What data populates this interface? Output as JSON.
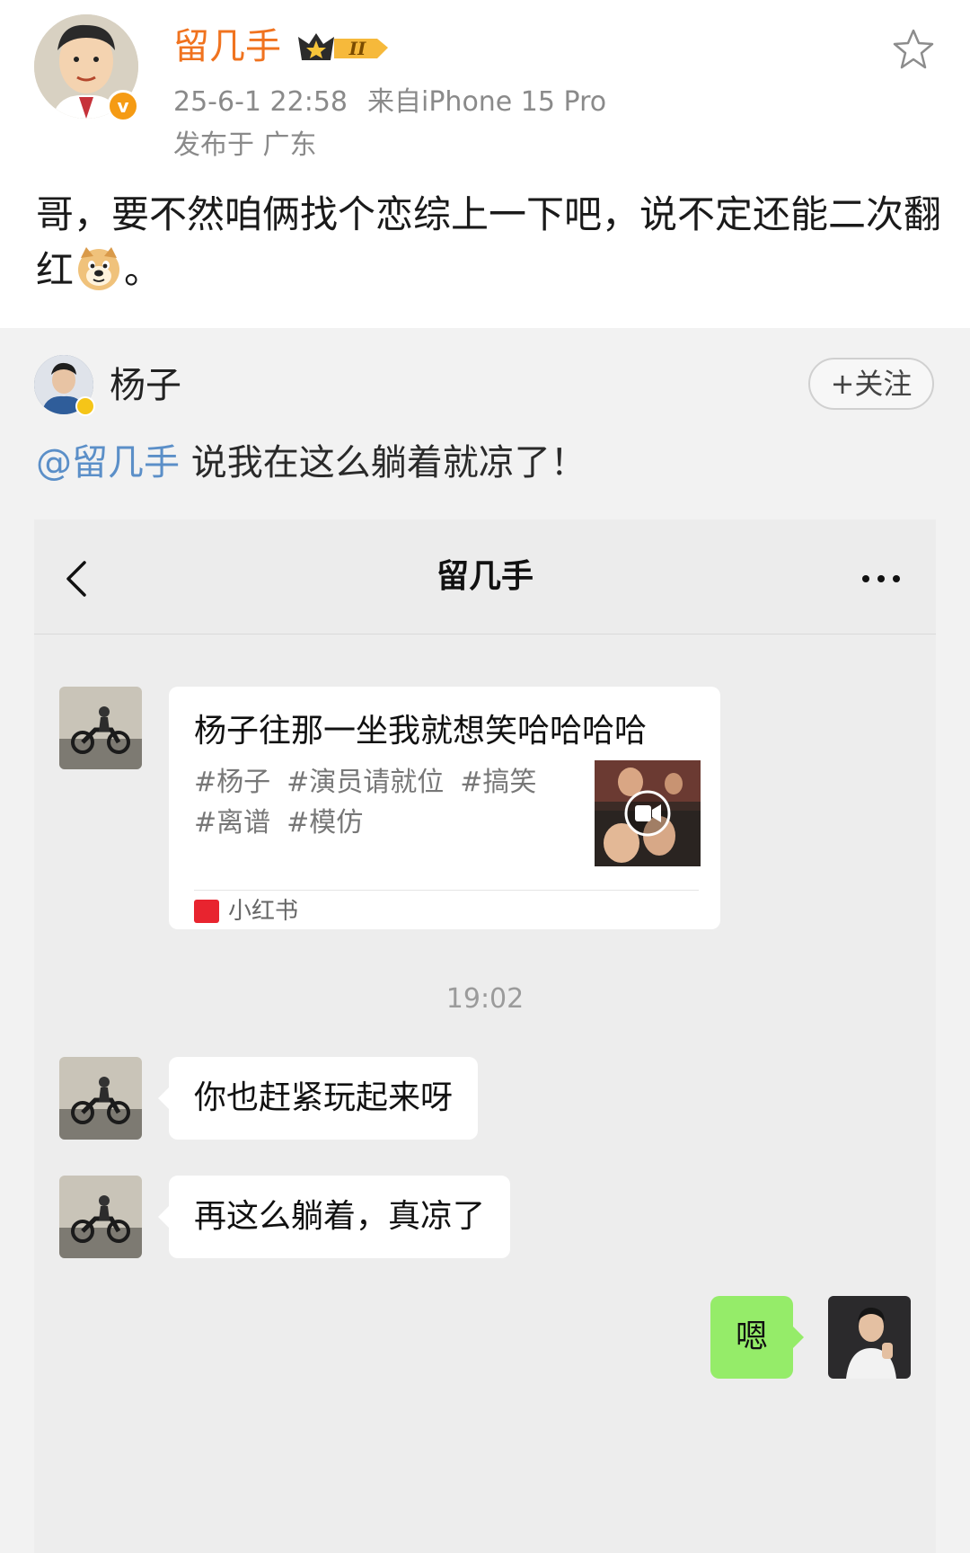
{
  "post": {
    "author": "留几手",
    "vip_label": "II",
    "time": "25-6-1 22:58",
    "source": "来自iPhone 15 Pro",
    "location": "发布于 广东",
    "text_before_emoji": "哥，要不然咱俩找个恋综上一下吧，说不定还能二次翻红",
    "emoji": "doge-emoji",
    "text_after_emoji": "。"
  },
  "repost": {
    "user": "杨子",
    "follow_label": "+关注",
    "mention": "@留几手",
    "text": " 说我在这么躺着就凉了！"
  },
  "chat": {
    "title": "留几手",
    "card": {
      "title": "杨子往那一坐我就想笑哈哈哈哈",
      "tags": [
        "#杨子",
        "#演员请就位",
        "#搞笑",
        "#离谱",
        "#模仿"
      ],
      "source": "小红书"
    },
    "timestamp": "19:02",
    "messages": [
      {
        "side": "left",
        "text": "你也赶紧玩起来呀"
      },
      {
        "side": "left",
        "text": "再这么躺着，真凉了"
      },
      {
        "side": "right",
        "text": "嗯"
      }
    ]
  },
  "colors": {
    "author": "#f0731f",
    "mention": "#5b8fc8",
    "my_bubble": "#95ec69",
    "xhs_red": "#e8242f"
  }
}
